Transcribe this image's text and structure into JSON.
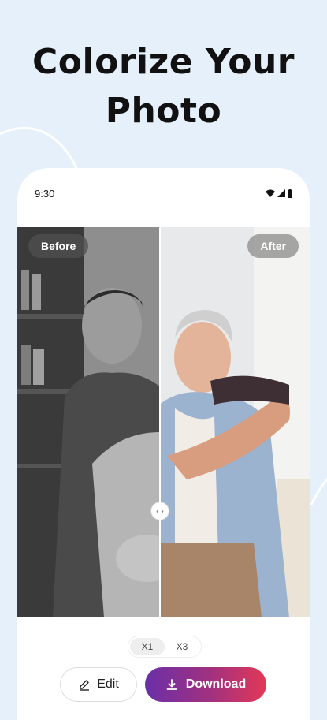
{
  "headline": {
    "line1": "Colorize Your",
    "line2": "Photo"
  },
  "status_bar": {
    "time": "9:30"
  },
  "comparison": {
    "before_label": "Before",
    "after_label": "After",
    "handle_glyph": "‹ ›"
  },
  "scale": {
    "options": [
      "X1",
      "X3"
    ],
    "selected": "X1"
  },
  "actions": {
    "edit_label": "Edit",
    "download_label": "Download"
  },
  "icons": {
    "wifi": "wifi-icon",
    "signal": "signal-icon",
    "battery": "battery-icon",
    "edit": "pencil-icon",
    "download": "download-icon",
    "compare": "compare-handle-icon"
  },
  "colors": {
    "background": "#e6f0fb",
    "download_gradient": [
      "#6a2fa7",
      "#a2317f",
      "#e33856"
    ]
  }
}
